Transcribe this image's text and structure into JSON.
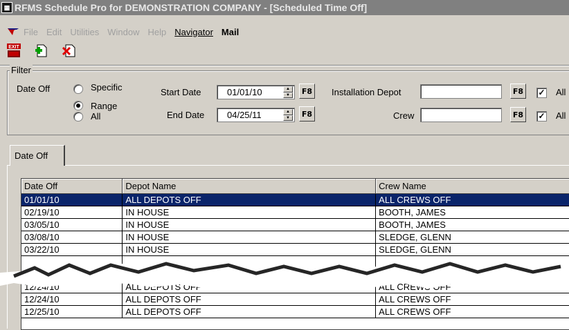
{
  "window": {
    "title": "RFMS Schedule Pro for DEMONSTRATION COMPANY - [Scheduled Time Off]"
  },
  "menu": [
    {
      "label": "File",
      "active": false
    },
    {
      "label": "Edit",
      "active": false
    },
    {
      "label": "Utilities",
      "active": false
    },
    {
      "label": "Window",
      "active": false
    },
    {
      "label": "Help",
      "active": false
    },
    {
      "label": "Navigator",
      "active": true
    },
    {
      "label": "Mail",
      "active": true
    }
  ],
  "toolbar": {
    "exit_label": "EXIT"
  },
  "filter": {
    "group_label": "Filter",
    "date_off_label": "Date Off",
    "radio_specific": "Specific",
    "radio_range": "Range",
    "radio_all": "All",
    "start_date_label": "Start Date",
    "start_date_value": "01/01/10",
    "end_date_label": "End Date",
    "end_date_value": "04/25/11",
    "f8_label": "F8",
    "installation_depot_label": "Installation Depot",
    "installation_depot_value": "",
    "crew_label": "Crew",
    "crew_value": "",
    "all_label": "All"
  },
  "tab": {
    "label": "Date Off"
  },
  "grid": {
    "columns": [
      "Date Off",
      "Depot Name",
      "Crew Name"
    ],
    "rows": [
      [
        "01/01/10",
        "ALL DEPOTS OFF",
        "ALL CREWS OFF"
      ],
      [
        "02/19/10",
        "IN HOUSE",
        "BOOTH, JAMES"
      ],
      [
        "03/05/10",
        "IN HOUSE",
        "BOOTH, JAMES"
      ],
      [
        "03/08/10",
        "IN HOUSE",
        "SLEDGE, GLENN"
      ],
      [
        "03/22/10",
        "IN HOUSE",
        "SLEDGE, GLENN"
      ],
      [
        "",
        "",
        ""
      ],
      [
        "12/24/10",
        "ALL DEPOTS OFF",
        "ALL CREWS OFF"
      ],
      [
        "12/24/10",
        "ALL DEPOTS OFF",
        "ALL CREWS OFF"
      ],
      [
        "12/25/10",
        "ALL DEPOTS OFF",
        "ALL CREWS OFF"
      ]
    ]
  }
}
